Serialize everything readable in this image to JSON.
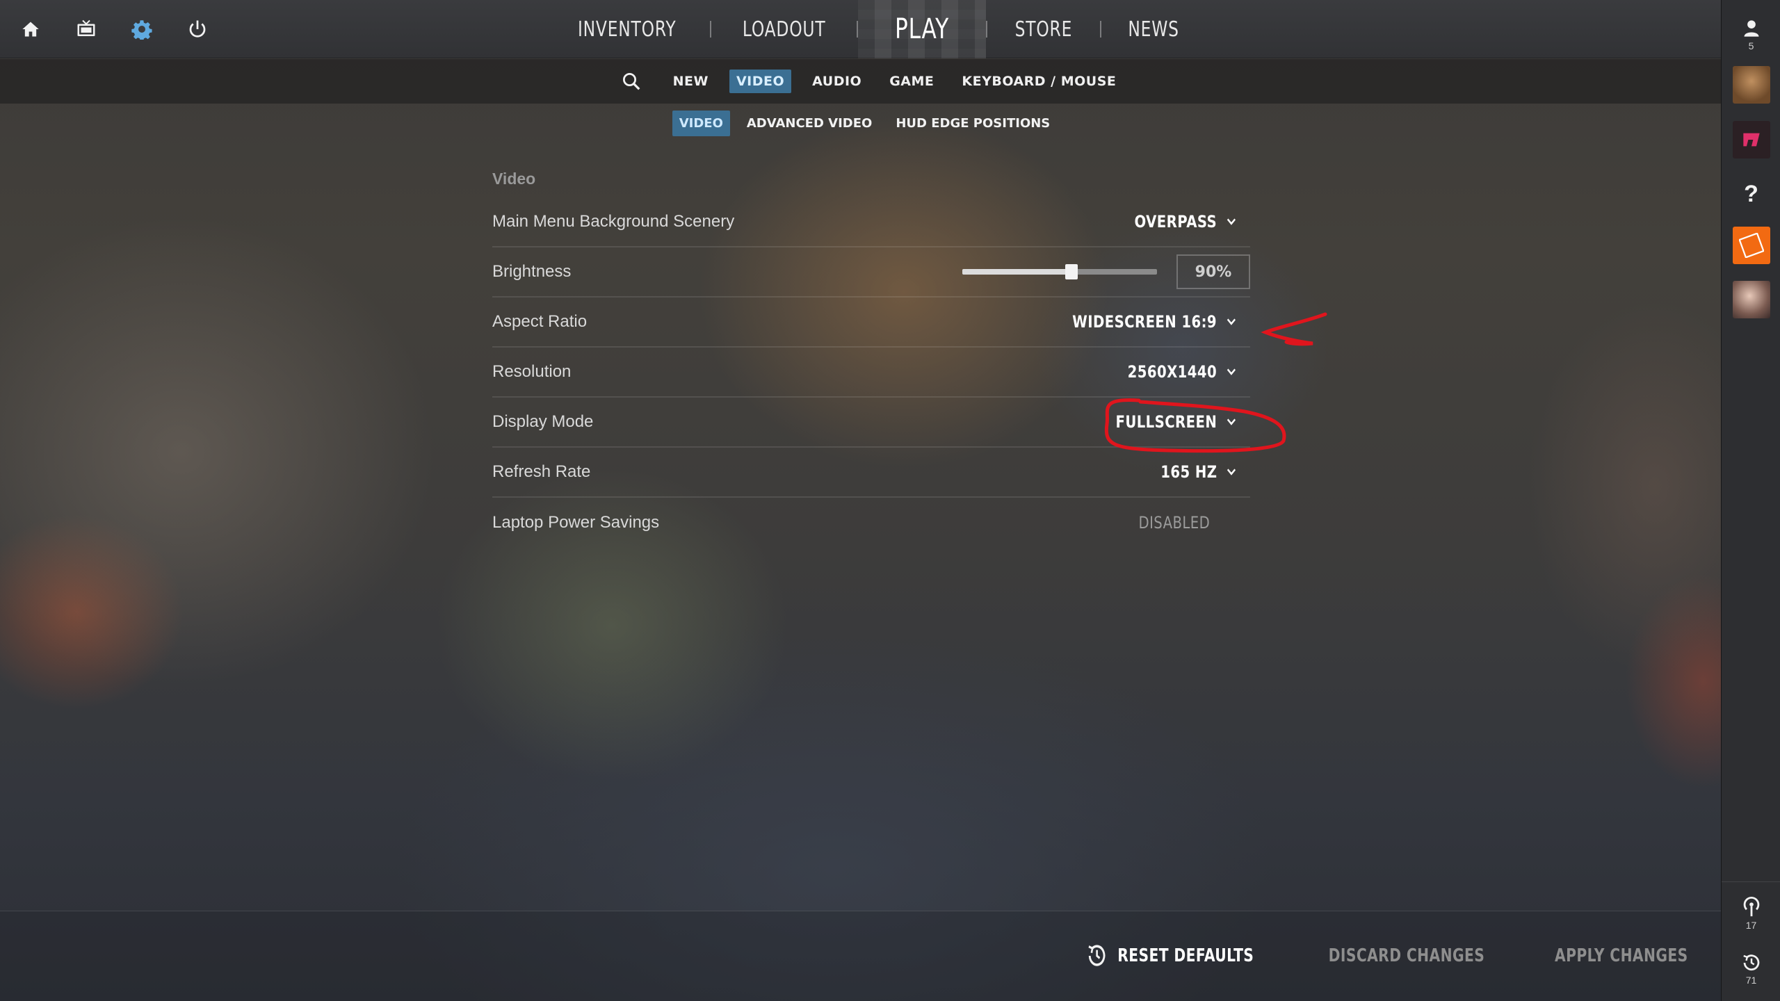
{
  "top_icons": [
    "home-icon",
    "tv-icon",
    "gear-icon",
    "power-icon"
  ],
  "nav": {
    "inventory": "INVENTORY",
    "loadout": "LOADOUT",
    "play": "PLAY",
    "store": "STORE",
    "news": "NEWS"
  },
  "settings_tabs": [
    "NEW",
    "VIDEO",
    "AUDIO",
    "GAME",
    "KEYBOARD / MOUSE"
  ],
  "active_settings_tab": "VIDEO",
  "video_subtabs": [
    "VIDEO",
    "ADVANCED VIDEO",
    "HUD EDGE POSITIONS"
  ],
  "active_video_subtab": "VIDEO",
  "section": {
    "title": "Video"
  },
  "settings": {
    "background_scenery": {
      "label": "Main Menu Background Scenery",
      "value": "OVERPASS"
    },
    "brightness": {
      "label": "Brightness",
      "value": "90%",
      "level": 0.56
    },
    "aspect_ratio": {
      "label": "Aspect Ratio",
      "value": "WIDESCREEN 16:9"
    },
    "resolution": {
      "label": "Resolution",
      "value": "2560X1440"
    },
    "display_mode": {
      "label": "Display Mode",
      "value": "FULLSCREEN"
    },
    "refresh_rate": {
      "label": "Refresh Rate",
      "value": "165 HZ"
    },
    "laptop_power": {
      "label": "Laptop Power Savings",
      "value": "DISABLED"
    }
  },
  "sidebar": {
    "friends_count": "5",
    "bottom_signal_count": "17",
    "bottom_history_count": "71"
  },
  "bottom_actions": {
    "reset": "RESET DEFAULTS",
    "discard": "DISCARD CHANGES",
    "apply": "APPLY CHANGES"
  },
  "colors": {
    "accent_tab": "#3b6f93",
    "annotation_red": "#e0151d"
  }
}
